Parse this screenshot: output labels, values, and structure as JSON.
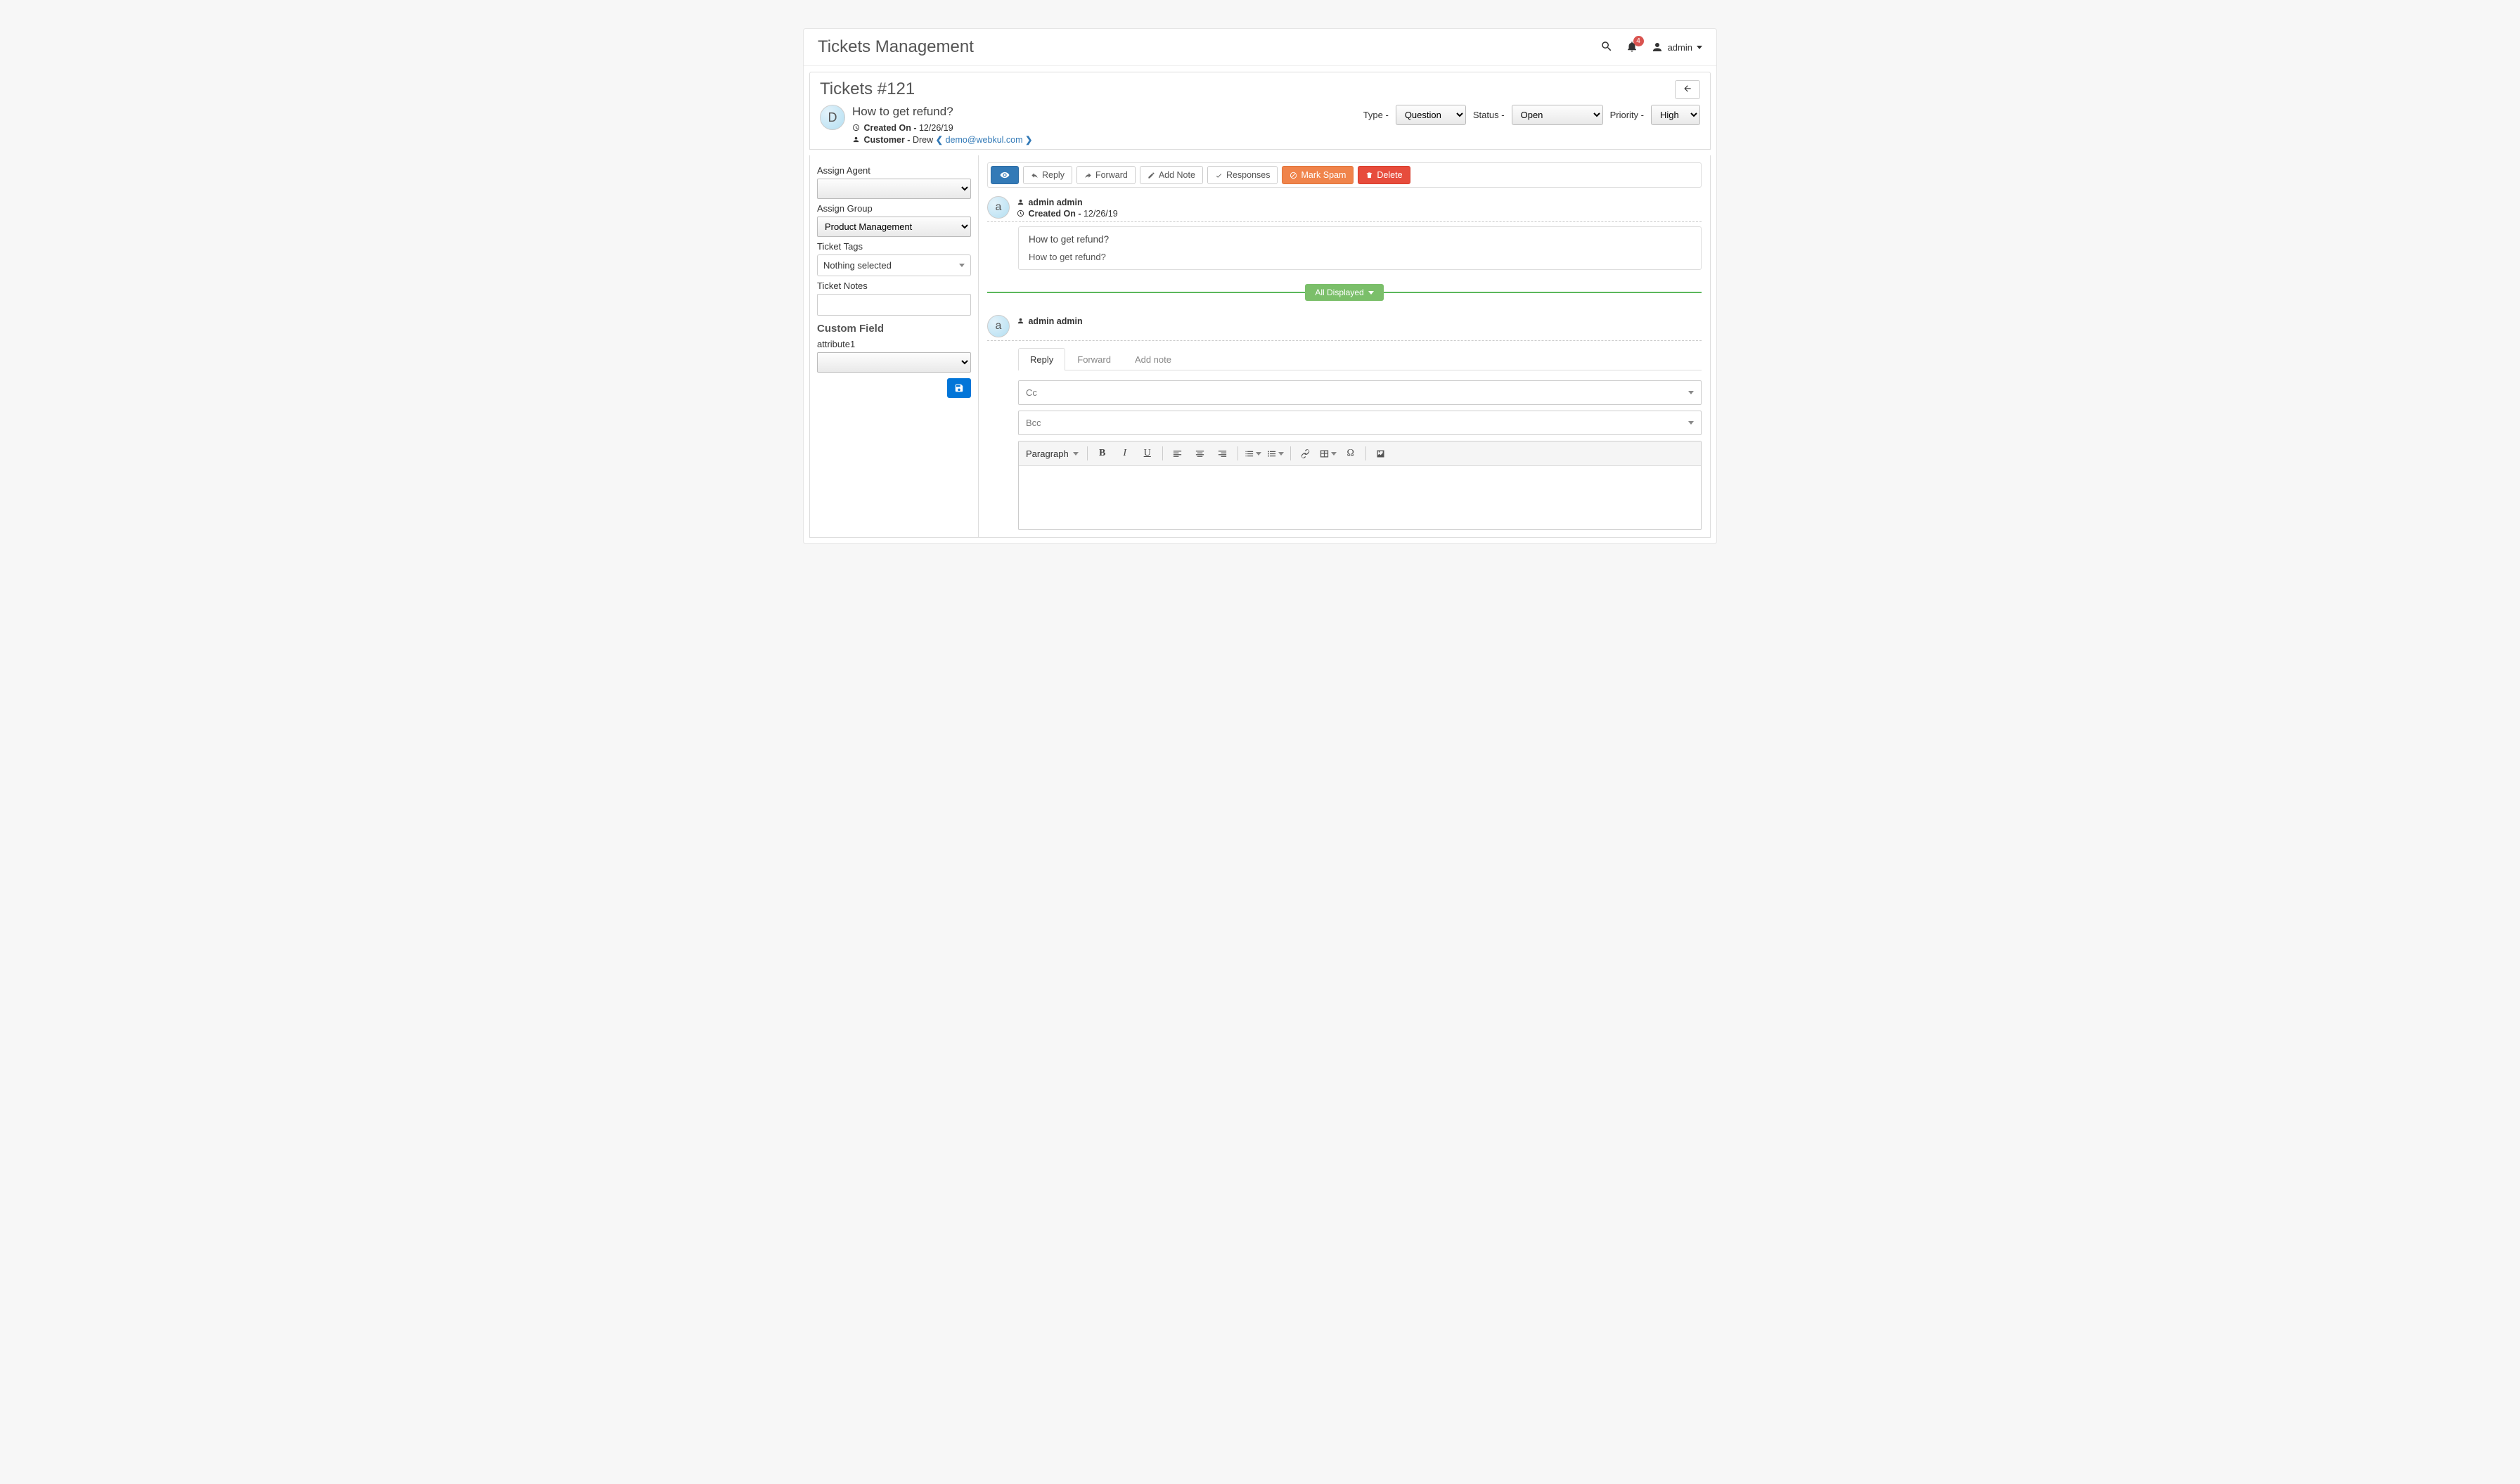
{
  "header": {
    "title": "Tickets Management",
    "notifications": "4",
    "username": "admin"
  },
  "ticket": {
    "title": "Tickets #121",
    "subject": "How to get refund?",
    "avatar_letter": "D",
    "created_label": "Created On -",
    "created_date": "12/26/19",
    "customer_label": "Customer -",
    "customer_name": "Drew",
    "customer_email": "demo@webkul.com",
    "type_label": "Type -",
    "type_value": "Question",
    "status_label": "Status -",
    "status_value": "Open",
    "priority_label": "Priority -",
    "priority_value": "High"
  },
  "sidebar": {
    "assign_agent_label": "Assign Agent",
    "assign_agent_value": "",
    "assign_group_label": "Assign Group",
    "assign_group_value": "Product Management",
    "ticket_tags_label": "Ticket Tags",
    "ticket_tags_value": "Nothing selected",
    "ticket_notes_label": "Ticket Notes",
    "custom_field_heading": "Custom Field",
    "attribute1_label": "attribute1"
  },
  "toolbar": {
    "reply": "Reply",
    "forward": "Forward",
    "add_note": "Add Note",
    "responses": "Responses",
    "mark_spam": "Mark Spam",
    "delete": "Delete"
  },
  "thread": {
    "avatar_letter": "a",
    "author": "admin admin",
    "created_label": "Created On -",
    "created_date": "12/26/19",
    "msg_title": "How to get refund?",
    "msg_body": "How to get refund?"
  },
  "all_displayed": "All Displayed",
  "reply_section": {
    "avatar_letter": "a",
    "author": "admin admin",
    "tabs": {
      "reply": "Reply",
      "forward": "Forward",
      "add_note": "Add note"
    },
    "cc": "Cc",
    "bcc": "Bcc",
    "paragraph": "Paragraph"
  }
}
